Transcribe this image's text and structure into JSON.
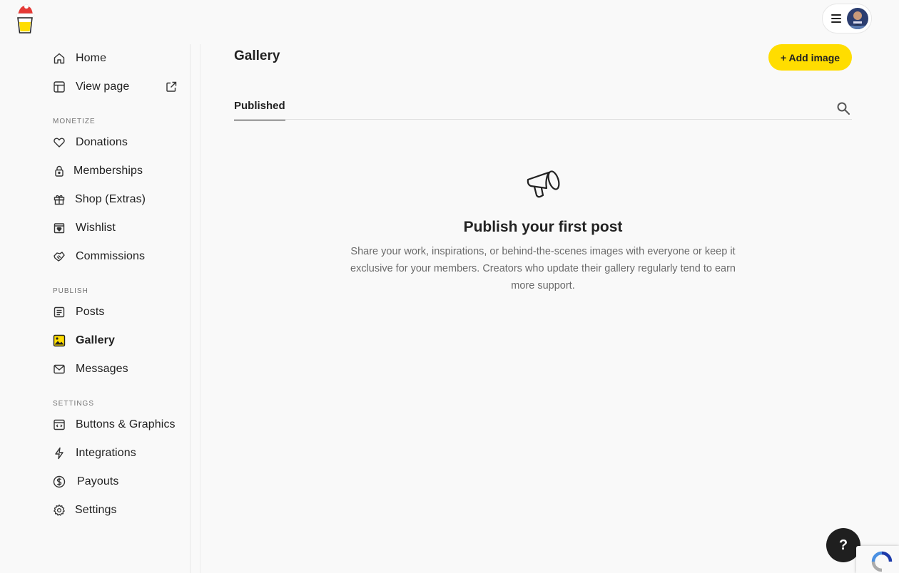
{
  "header": {
    "logo_icon": "coffee-cup-santa-hat-logo",
    "menu_icon": "hamburger-icon",
    "avatar_icon": "user-avatar"
  },
  "sidebar": {
    "home": {
      "label": "Home",
      "icon": "home-icon"
    },
    "view_page": {
      "label": "View page",
      "icon": "layout-icon",
      "external_icon": "external-link-icon"
    },
    "sections": {
      "monetize": "MONETIZE",
      "publish": "PUBLISH",
      "settings": "SETTINGS"
    },
    "items": {
      "donations": {
        "label": "Donations",
        "icon": "heart-icon"
      },
      "memberships": {
        "label": "Memberships",
        "icon": "lock-icon"
      },
      "shop": {
        "label": "Shop (Extras)",
        "icon": "gift-icon"
      },
      "wishlist": {
        "label": "Wishlist",
        "icon": "wishlist-icon"
      },
      "commissions": {
        "label": "Commissions",
        "icon": "handshake-icon"
      },
      "posts": {
        "label": "Posts",
        "icon": "document-icon"
      },
      "gallery": {
        "label": "Gallery",
        "icon": "image-icon",
        "active": true
      },
      "messages": {
        "label": "Messages",
        "icon": "mail-icon"
      },
      "buttons_graphics": {
        "label": "Buttons & Graphics",
        "icon": "code-window-icon"
      },
      "integrations": {
        "label": "Integrations",
        "icon": "lightning-icon"
      },
      "payouts": {
        "label": "Payouts",
        "icon": "dollar-icon"
      },
      "settings": {
        "label": "Settings",
        "icon": "gear-icon"
      }
    }
  },
  "main": {
    "title": "Gallery",
    "add_button": "+ Add image",
    "tabs": [
      {
        "label": "Published",
        "active": true
      }
    ],
    "search_icon": "search-icon",
    "empty_state": {
      "icon": "megaphone-icon",
      "title": "Publish your first post",
      "description": "Share your work, inspirations, or behind-the-scenes images with everyone or keep it exclusive for your members. Creators who update their gallery regularly tend to earn more support."
    }
  },
  "help": {
    "label": "?"
  },
  "colors": {
    "accent": "#ffdd00",
    "text": "#222222",
    "muted": "#6b6b6b",
    "background": "#f9f9f9"
  }
}
